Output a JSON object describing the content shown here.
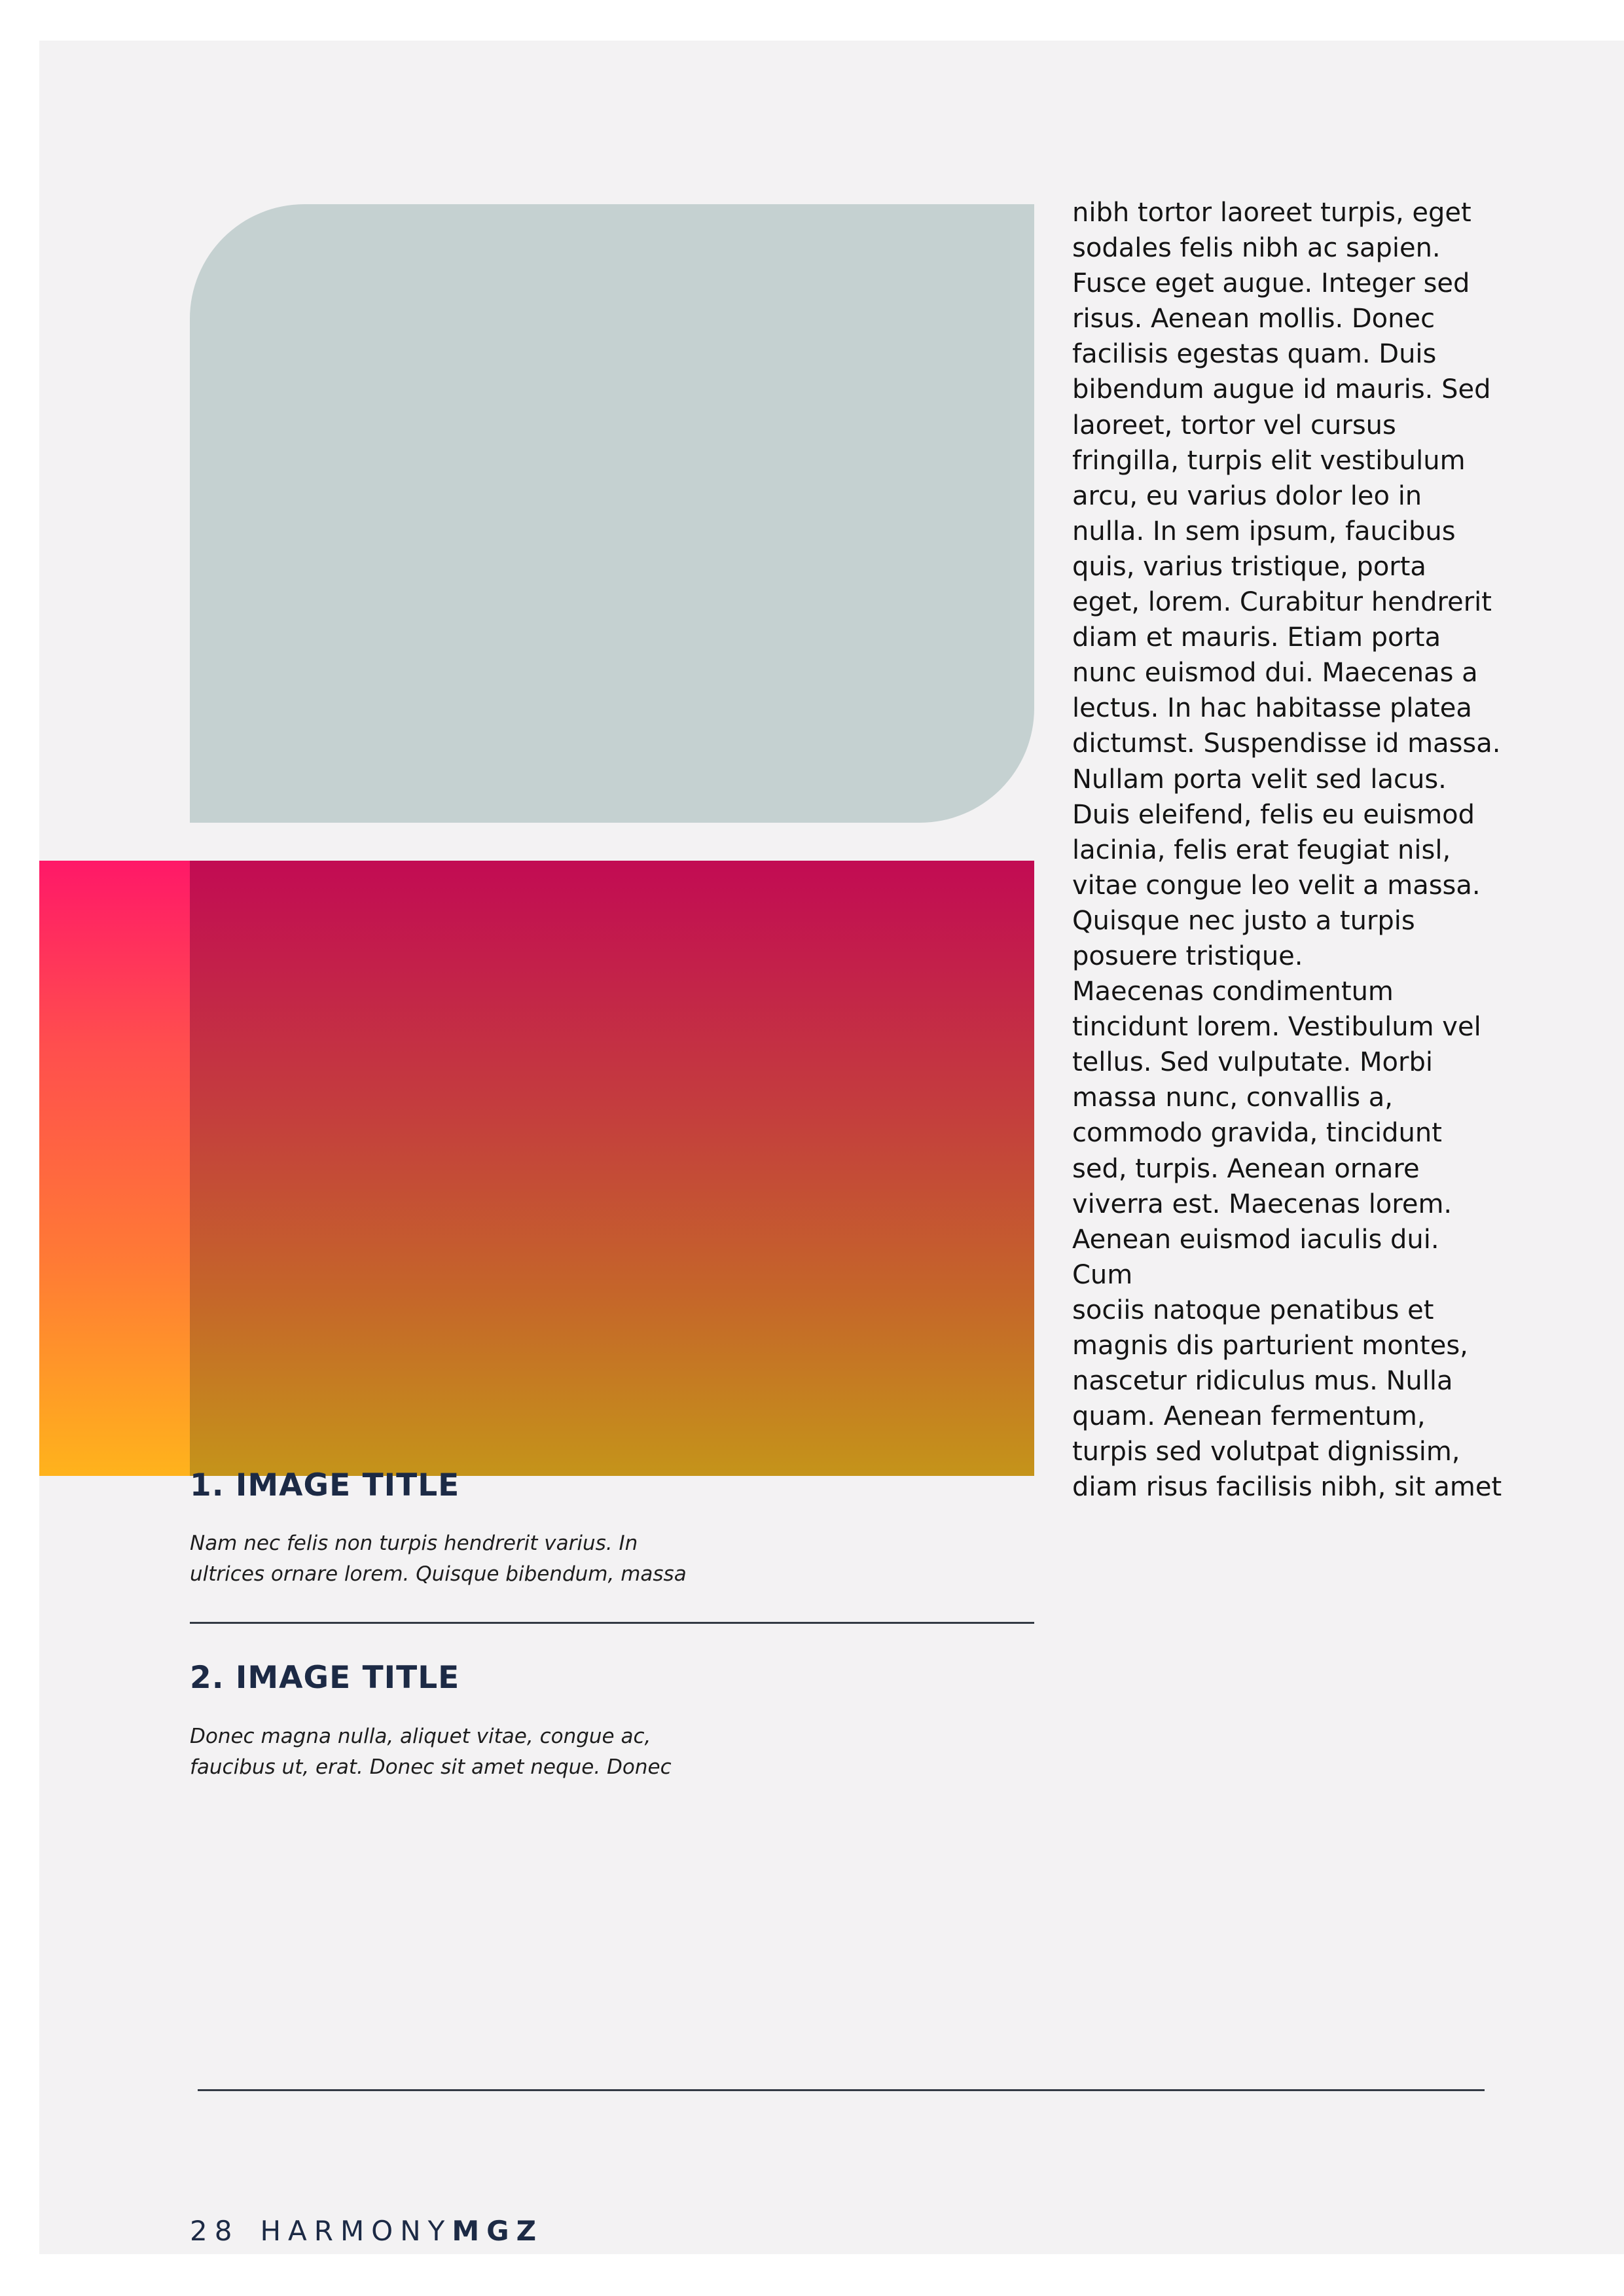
{
  "body_text": "nibh tortor laoreet turpis, eget\nsodales felis  nibh ac sapien.\nFusce eget augue. Integer sed\nrisus. Aenean mollis. Donec\nfacilisis egestas quam. Duis\nbibendum augue  id mauris. Sed\nlaoreet, tortor vel cursus\nfringilla, turpis elit vestibulum\narcu, eu varius dolor leo in\nnulla. In sem ipsum, faucibus\nquis, varius tristique, porta\neget, lorem. Curabitur hendrerit\ndiam et mauris. Etiam porta\nnunc euismod dui. Maecenas a\nlectus. In hac habitasse platea\ndictumst. Suspendisse id massa.\nNullam porta velit sed lacus.\nDuis eleifend, felis eu euismod\nlacinia, felis erat feugiat nisl,\nvitae congue leo velit a massa.\nQuisque nec justo a turpis\nposuere tristique.\nMaecenas condimentum\ntincidunt lorem. Vestibulum vel\ntellus. Sed vulputate. Morbi\nmassa nunc, convallis a,\ncommodo gravida, tincidunt\nsed, turpis. Aenean ornare\nviverra est. Maecenas lorem.\nAenean euismod iaculis dui. Cum\nsociis natoque penatibus et\nmagnis dis parturient montes,\nnascetur ridiculus mus. Nulla\nquam. Aenean fermentum,\nturpis sed volutpat dignissim,\ndiam risus facilisis nibh, sit amet",
  "captions": [
    {
      "title": "1. IMAGE TITLE",
      "text": "Nam nec felis non turpis hendrerit varius. In\nultrices ornare lorem. Quisque bibendum, massa"
    },
    {
      "title": "2. IMAGE TITLE",
      "text": "Donec magna nulla, aliquet vitae, congue ac,\nfaucibus ut, erat. Donec sit amet neque. Donec"
    }
  ],
  "footer": {
    "page_number": "28",
    "brand_light": "HARMONY",
    "brand_bold": "MGZ"
  },
  "colors": {
    "page_background": "#f3f2f3",
    "image_placeholder": "#c5d1d1",
    "gradient_top": "#c20b53",
    "gradient_bottom": "#c5941a",
    "accent_top": "#ff1868",
    "accent_bottom": "#ffb31c",
    "heading_navy": "#1c2a45"
  }
}
